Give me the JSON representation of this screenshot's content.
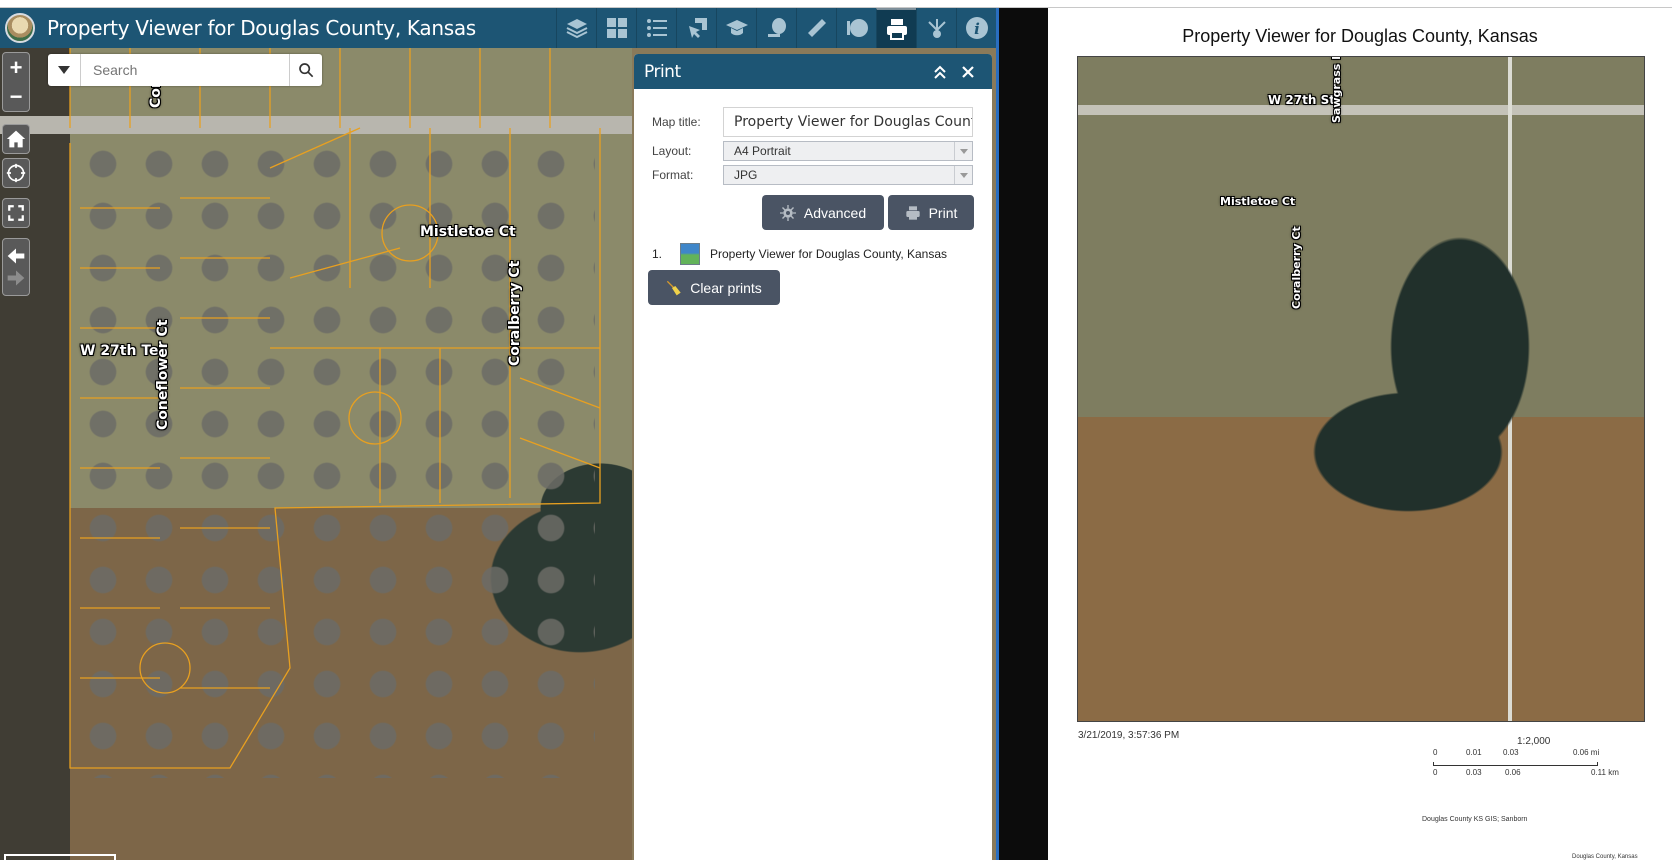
{
  "app": {
    "title": "Property Viewer for Douglas County, Kansas",
    "logo": "douglas-county-seal"
  },
  "toolbar": {
    "tools": [
      {
        "name": "layers",
        "icon": "layers-icon",
        "active": false
      },
      {
        "name": "basemap-gallery",
        "icon": "grid-icon",
        "active": false
      },
      {
        "name": "legend",
        "icon": "list-icon",
        "active": false
      },
      {
        "name": "select",
        "icon": "select-icon",
        "active": false
      },
      {
        "name": "education",
        "icon": "graduation-cap-icon",
        "active": false
      },
      {
        "name": "tape",
        "icon": "tape-icon",
        "active": false
      },
      {
        "name": "measurement",
        "icon": "ruler-icon",
        "active": false
      },
      {
        "name": "draw",
        "icon": "palette-icon",
        "active": false
      },
      {
        "name": "print",
        "icon": "printer-icon",
        "active": true
      },
      {
        "name": "share",
        "icon": "share-icon",
        "active": false
      },
      {
        "name": "about",
        "icon": "info-icon",
        "active": false
      }
    ]
  },
  "map": {
    "search": {
      "placeholder": "Search",
      "value": ""
    },
    "controls": {
      "zoom_in": "+",
      "zoom_out": "−"
    },
    "labels": {
      "w27th_ter": "W 27th Ter",
      "coneflower": "Coneflower Ct",
      "mistletoe": "Mistletoe Ct",
      "coralberry": "Coralberry Ct",
      "top_label": "Con"
    }
  },
  "print_panel": {
    "title": "Print",
    "map_title_label": "Map title:",
    "map_title_value": "Property Viewer for Douglas County",
    "layout_label": "Layout:",
    "layout_value": "A4 Portrait",
    "format_label": "Format:",
    "format_value": "JPG",
    "advanced_label": "Advanced",
    "print_label": "Print",
    "results": [
      {
        "num": "1.",
        "name": "Property Viewer for Douglas County, Kansas"
      }
    ],
    "clear_label": "Clear prints"
  },
  "preview": {
    "title": "Property Viewer for Douglas County, Kansas",
    "labels": {
      "w27th_st": "W 27th St",
      "sawgrass": "Sawgrass Dr",
      "mistletoe": "Mistletoe Ct",
      "coralberry": "Coralberry Ct"
    },
    "date": "3/21/2019, 3:57:36 PM",
    "scale": "1:2,000",
    "scale_mi": [
      "0",
      "0.01",
      "0.03",
      "0.06 mi"
    ],
    "scale_km": [
      "0",
      "0.03",
      "0.06",
      "0.11 km"
    ],
    "credit": "Douglas County KS GIS; Sanborn",
    "footer": "Douglas County, Kansas"
  }
}
